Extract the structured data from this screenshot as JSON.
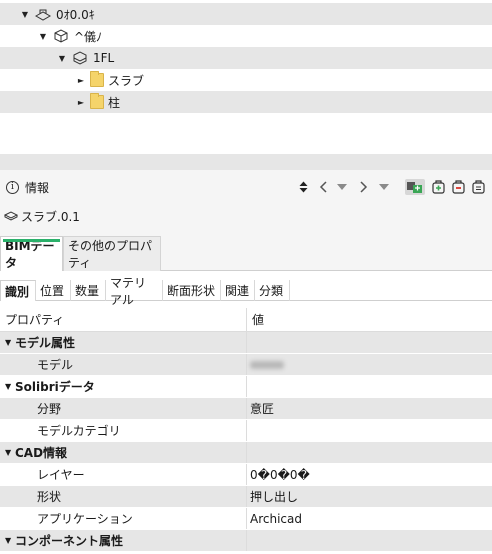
{
  "tree": {
    "rows": [
      {
        "label": "0ｵ0.0ｷ",
        "icon": "site-icon"
      },
      {
        "label": "^儀ﾉ",
        "icon": "building-icon"
      },
      {
        "label": "1FL",
        "icon": "floor-icon"
      },
      {
        "label": "スラブ",
        "icon": "folder-icon"
      },
      {
        "label": "柱",
        "icon": "folder-icon"
      }
    ]
  },
  "info": {
    "title": "情報",
    "object_name": "スラブ.0.1"
  },
  "tabs": {
    "main": [
      "BIMデータ",
      "その他のプロパティ"
    ],
    "sub": [
      "識別",
      "位置",
      "数量",
      "マテリアル",
      "断面形状",
      "関連",
      "分類"
    ]
  },
  "table": {
    "header": {
      "property": "プロパティ",
      "value": "値"
    },
    "rows": [
      {
        "kind": "group",
        "label": "モデル属性",
        "value": ""
      },
      {
        "kind": "item",
        "label": "モデル",
        "value": ""
      },
      {
        "kind": "group",
        "label": "Solibriデータ",
        "value": ""
      },
      {
        "kind": "item",
        "label": "分野",
        "value": "意匠"
      },
      {
        "kind": "item",
        "label": "モデルカテゴリ",
        "value": ""
      },
      {
        "kind": "group",
        "label": "CAD情報",
        "value": ""
      },
      {
        "kind": "item",
        "label": "レイヤー",
        "value": "0�0�0�"
      },
      {
        "kind": "item",
        "label": "形状",
        "value": "押し出し"
      },
      {
        "kind": "item",
        "label": "アプリケーション",
        "value": "Archicad"
      },
      {
        "kind": "group",
        "label": "コンポーネント属性",
        "value": ""
      }
    ]
  },
  "colors": {
    "accent": "#2ab06a",
    "toolbar_green": "#3aa655",
    "toolbar_red": "#d9342b"
  }
}
